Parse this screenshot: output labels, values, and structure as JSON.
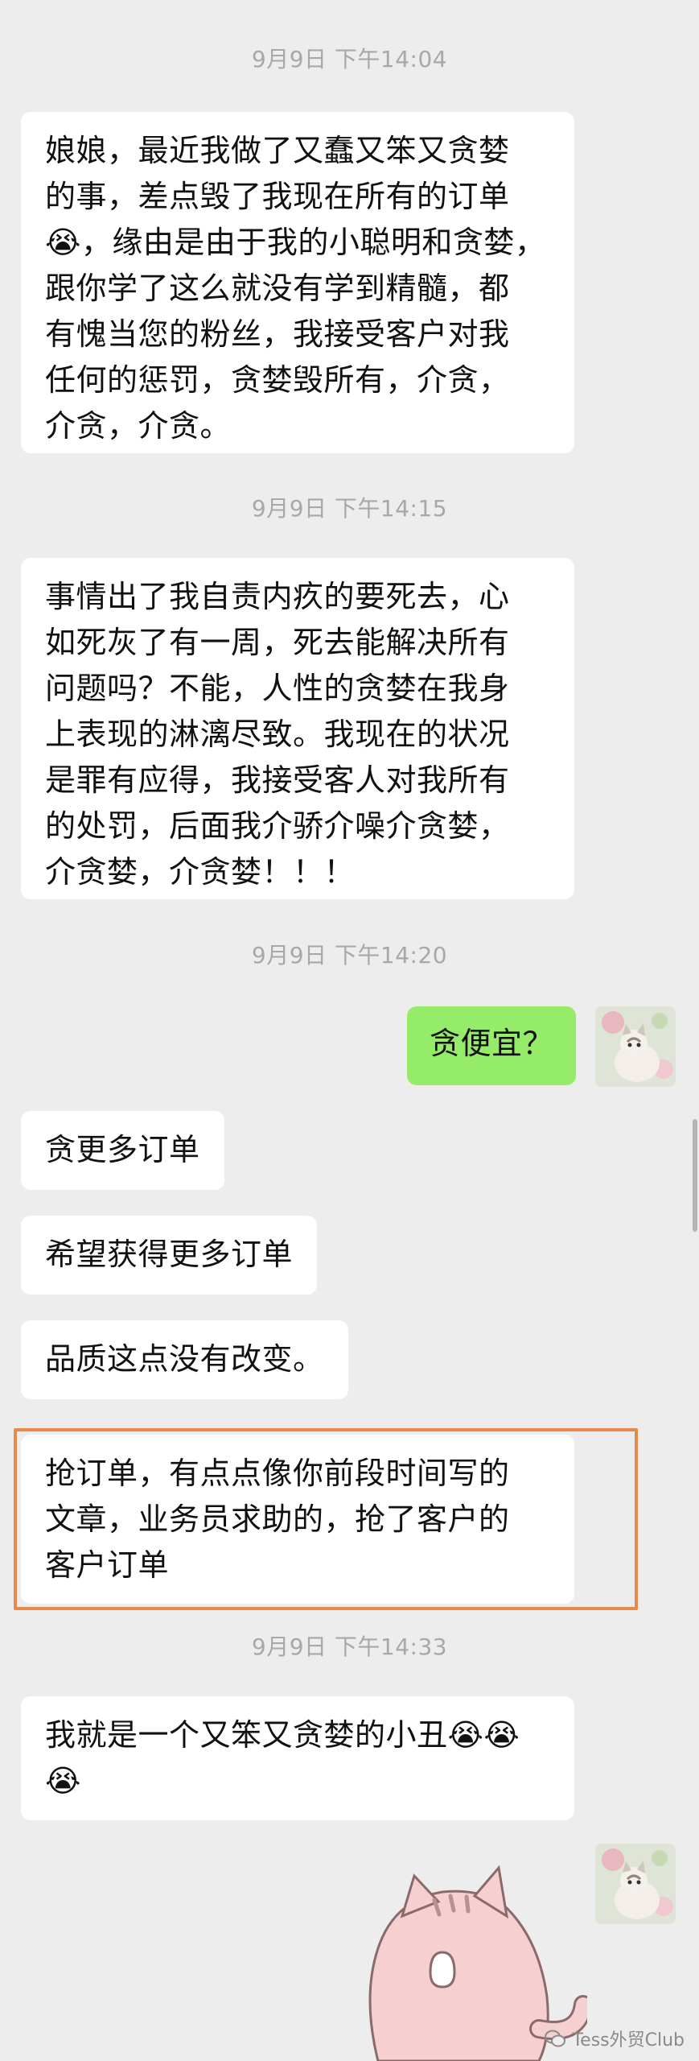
{
  "timestamps": [
    "9月9日 下午14:04",
    "9月9日 下午14:15",
    "9月9日 下午14:20",
    "9月9日 下午14:33"
  ],
  "messages": [
    {
      "lines": [
        "娘娘，最近我做了又蠢又笨又贪婪",
        "的事，差点毁了我现在所有的订单",
        "😭，缘由是由于我的小聪明和贪婪，",
        "跟你学了这么就没有学到精髓，都",
        "有愧当您的粉丝，我接受客户对我",
        "任何的惩罚，贪婪毁所有，介贪，",
        "介贪，介贪。"
      ]
    },
    {
      "lines": [
        "事情出了我自责内疚的要死去，心",
        "如死灰了有一周，死去能解决所有",
        "问题吗？不能，人性的贪婪在我身",
        "上表现的淋漓尽致。我现在的状况",
        "是罪有应得，我接受客人对我所有",
        "的处罚，后面我介骄介噪介贪婪，",
        "介贪婪，介贪婪！！！"
      ]
    },
    {
      "lines": [
        "贪便宜？"
      ]
    },
    {
      "lines": [
        "贪更多订单"
      ]
    },
    {
      "lines": [
        "希望获得更多订单"
      ]
    },
    {
      "lines": [
        "品质这点没有改变。"
      ]
    },
    {
      "lines": [
        "抢订单，有点点像你前段时间写的",
        "文章，业务员求助的，抢了客户的",
        "客户订单"
      ]
    },
    {
      "lines": [
        "我就是一个又笨又贪婪的小丑😭😭",
        "😭"
      ]
    }
  ],
  "watermark": "Tess外贸Club",
  "colors": {
    "my_bubble": "#95ec69",
    "their_bubble": "#ffffff",
    "background": "#ededed",
    "highlight_border": "#e8894a"
  }
}
